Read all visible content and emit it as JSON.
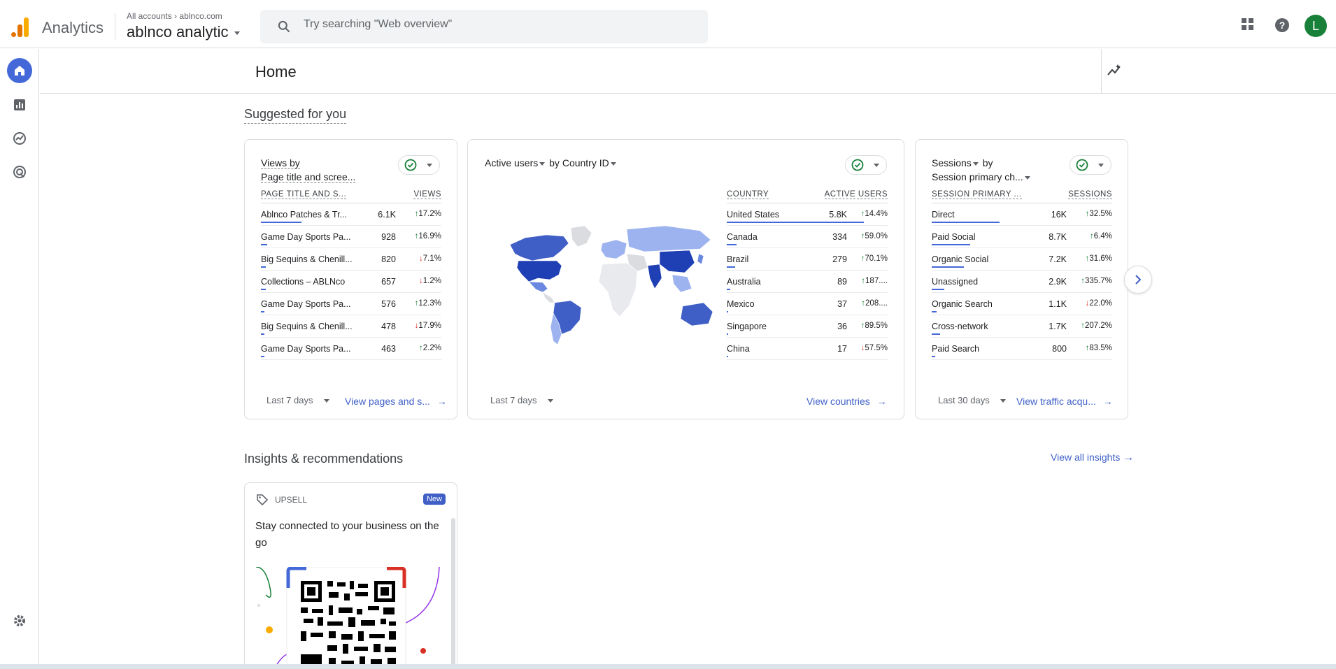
{
  "topbar": {
    "brand": "Analytics",
    "account_crumb_prefix": "All accounts",
    "account_crumb_site": "ablnco.com",
    "account_name": "ablnco analytic",
    "search_placeholder": "Try searching \"Web overview\"",
    "avatar_letter": "L",
    "colors": {
      "logo_dark": "#e37400",
      "logo_light": "#f9ab00",
      "avatar": "#188038"
    }
  },
  "page": {
    "title": "Home"
  },
  "suggested": {
    "title": "Suggested for you",
    "cards": [
      {
        "title_line1": "Views by",
        "title_line2": "Page title and scree...",
        "col1": "PAGE TITLE AND S...",
        "col2": "VIEWS",
        "rows": [
          {
            "label": "Ablnco Patches & Tr...",
            "value": "6.1K",
            "change": "17.2%",
            "dir": "up",
            "bar": 0.25
          },
          {
            "label": "Game Day Sports Pa...",
            "value": "928",
            "change": "16.9%",
            "dir": "up",
            "bar": 0.04
          },
          {
            "label": "Big Sequins & Chenill...",
            "value": "820",
            "change": "7.1%",
            "dir": "down",
            "bar": 0.03
          },
          {
            "label": "Collections – ABLNco",
            "value": "657",
            "change": "1.2%",
            "dir": "down",
            "bar": 0.03
          },
          {
            "label": "Game Day Sports Pa...",
            "value": "576",
            "change": "12.3%",
            "dir": "up",
            "bar": 0.02
          },
          {
            "label": "Big Sequins & Chenill...",
            "value": "478",
            "change": "17.9%",
            "dir": "down",
            "bar": 0.02
          },
          {
            "label": "Game Day Sports Pa...",
            "value": "463",
            "change": "2.2%",
            "dir": "up",
            "bar": 0.02
          }
        ],
        "range": "Last 7 days",
        "link": "View pages and s..."
      },
      {
        "title_metric": "Active users",
        "title_by": "by",
        "title_dim": "Country ID",
        "col1": "COUNTRY",
        "col2": "ACTIVE USERS",
        "rows": [
          {
            "label": "United States",
            "value": "5.8K",
            "change": "14.4%",
            "dir": "up",
            "bar": 0.85
          },
          {
            "label": "Canada",
            "value": "334",
            "change": "59.0%",
            "dir": "up",
            "bar": 0.06
          },
          {
            "label": "Brazil",
            "value": "279",
            "change": "70.1%",
            "dir": "up",
            "bar": 0.05
          },
          {
            "label": "Australia",
            "value": "89",
            "change": "187....",
            "dir": "up",
            "bar": 0.02
          },
          {
            "label": "Mexico",
            "value": "37",
            "change": "208....",
            "dir": "up",
            "bar": 0.01
          },
          {
            "label": "Singapore",
            "value": "36",
            "change": "89.5%",
            "dir": "up",
            "bar": 0.01
          },
          {
            "label": "China",
            "value": "17",
            "change": "57.5%",
            "dir": "down",
            "bar": 0.005
          }
        ],
        "range": "Last 7 days",
        "link": "View countries"
      },
      {
        "title_metric": "Sessions",
        "title_by": "by",
        "title_dim": "Session primary ch...",
        "col1": "SESSION PRIMARY ...",
        "col2": "SESSIONS",
        "rows": [
          {
            "label": "Direct",
            "value": "16K",
            "change": "32.5%",
            "dir": "up",
            "bar": 0.42
          },
          {
            "label": "Paid Social",
            "value": "8.7K",
            "change": "6.4%",
            "dir": "up",
            "bar": 0.24
          },
          {
            "label": "Organic Social",
            "value": "7.2K",
            "change": "31.6%",
            "dir": "up",
            "bar": 0.2
          },
          {
            "label": "Unassigned",
            "value": "2.9K",
            "change": "335.7%",
            "dir": "up",
            "bar": 0.08
          },
          {
            "label": "Organic Search",
            "value": "1.1K",
            "change": "22.0%",
            "dir": "down",
            "bar": 0.03
          },
          {
            "label": "Cross-network",
            "value": "1.7K",
            "change": "207.2%",
            "dir": "up",
            "bar": 0.05
          },
          {
            "label": "Paid Search",
            "value": "800",
            "change": "83.5%",
            "dir": "up",
            "bar": 0.02
          }
        ],
        "range": "Last 30 days",
        "link": "View traffic acqu..."
      }
    ]
  },
  "insights": {
    "title": "Insights & recommendations",
    "view_all": "View all insights",
    "card": {
      "tag": "UPSELL",
      "badge": "New",
      "message": "Stay connected to your business on the go"
    }
  },
  "colors": {
    "accent": "#4468d8",
    "up": "#188038",
    "down": "#d93025",
    "link": "#3f5fc6"
  }
}
